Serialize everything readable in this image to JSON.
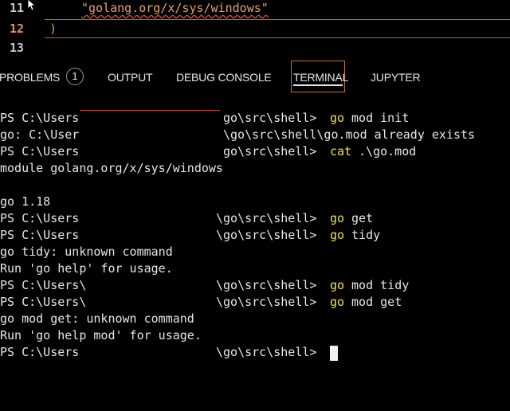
{
  "editor": {
    "lines": [
      {
        "num": "11",
        "text": "\"golang.org/x/sys/windows\""
      },
      {
        "num": "12",
        "text": ")"
      },
      {
        "num": "13",
        "text": ""
      }
    ]
  },
  "panel": {
    "tabs": [
      {
        "label": "PROBLEMS"
      },
      {
        "label": "OUTPUT"
      },
      {
        "label": "DEBUG CONSOLE"
      },
      {
        "label": "TERMINAL"
      },
      {
        "label": "JUPYTER"
      }
    ],
    "problems_count": "1"
  },
  "terminal": {
    "lines": [
      {
        "left": "PS C:\\Users",
        "right": "go\\src\\shell>",
        "cmd": " go",
        "rest": " mod init"
      },
      {
        "left": "go: C:\\User",
        "right": "\\go\\src\\shell\\go.mod already exists",
        "cmd": "",
        "rest": ""
      },
      {
        "left": "PS C:\\Users",
        "right": "go\\src\\shell>",
        "cmd": " cat",
        "rest": " .\\go.mod"
      },
      {
        "left": "module golang.org/x/sys/windows",
        "right": "",
        "cmd": "",
        "rest": ""
      },
      {
        "left": "",
        "right": "",
        "cmd": "",
        "rest": ""
      },
      {
        "left": "go 1.18",
        "right": "",
        "cmd": "",
        "rest": ""
      },
      {
        "left": "PS C:\\Users",
        "right": "\\go\\src\\shell>",
        "cmd": " go",
        "rest": " get"
      },
      {
        "left": "PS C:\\Users",
        "right": "\\go\\src\\shell>",
        "cmd": " go",
        "rest": " tidy"
      },
      {
        "left": "go tidy: unknown command",
        "right": "",
        "cmd": "",
        "rest": ""
      },
      {
        "left": "Run 'go help' for usage.",
        "right": "",
        "cmd": "",
        "rest": ""
      },
      {
        "left": "PS C:\\Users\\",
        "right": "\\go\\src\\shell>",
        "cmd": " go",
        "rest": " mod tidy"
      },
      {
        "left": "PS C:\\Users\\",
        "right": "\\go\\src\\shell>",
        "cmd": " go",
        "rest": " mod get"
      },
      {
        "left": "go mod get: unknown command",
        "right": "",
        "cmd": "",
        "rest": ""
      },
      {
        "left": "Run 'go help mod' for usage.",
        "right": "",
        "cmd": "",
        "rest": ""
      },
      {
        "left": "PS C:\\Users",
        "right": "\\go\\src\\shell>",
        "cmd": "",
        "rest": ""
      }
    ]
  },
  "colors": {
    "background": "#000000",
    "command": "#f1e34a",
    "string": "#e8a06a",
    "active_tab_border": "#c8701e",
    "active_line_number": "#e8973a"
  }
}
